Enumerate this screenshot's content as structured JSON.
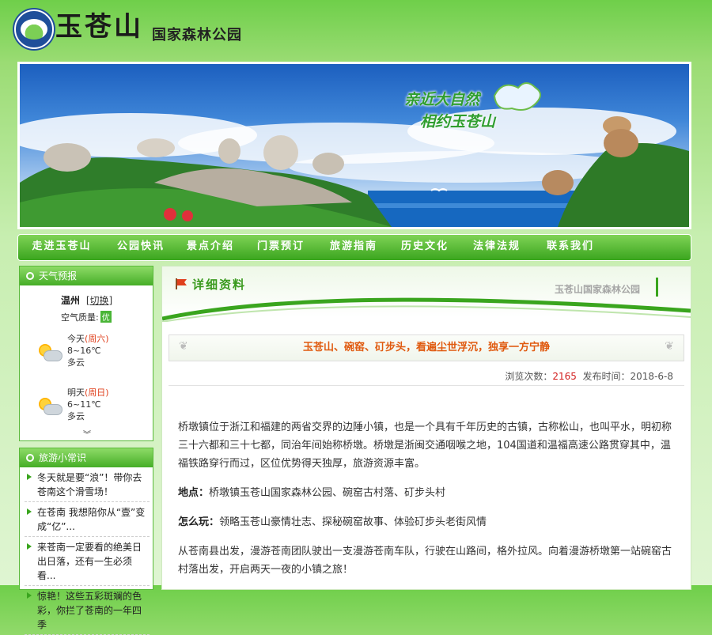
{
  "site": {
    "brand": "玉苍山",
    "subtitle": "国家森林公园"
  },
  "banner": {
    "slogan_line1": "亲近大自然",
    "slogan_line2": "相约玉苍山"
  },
  "nav": {
    "items": [
      "走进玉苍山",
      "公园快讯",
      "景点介绍",
      "门票预订",
      "旅游指南",
      "历史文化",
      "法律法规",
      "联系我们"
    ]
  },
  "weather": {
    "title": "天气预报",
    "city": "温州",
    "switch": "[切换]",
    "air_quality_label": "空气质量:",
    "air_quality_value": "优",
    "days": [
      {
        "label": "今天",
        "weekday": "(周六)",
        "temp": "8~16℃",
        "cond": "多云"
      },
      {
        "label": "明天",
        "weekday": "(周日)",
        "temp": "6~11℃",
        "cond": "多云"
      }
    ],
    "more": "︾"
  },
  "tips": {
    "title": "旅游小常识",
    "items": [
      "冬天就是要“浪”！带你去苍南这个滑雪场！",
      "在苍南 我想陪你从“壹”变成“亿”...",
      "来苍南一定要看的绝美日出日落，还有一生必须看...",
      "惊艳！这些五彩斑斓的色彩，你拦了苍南的一年四季"
    ]
  },
  "main": {
    "title": "详细资料",
    "watermark": "玉苍山国家森林公园",
    "headline": "玉苍山、碗窑、矴步头，看遍尘世浮沉，独享一方宁静",
    "views_label": "浏览次数：",
    "views": "2165",
    "date_label": "发布时间：",
    "date": "2018-6-8",
    "para1": "桥墩镇位于浙江和福建的两省交界的边陲小镇，也是一个具有千年历史的古镇，古称松山，也叫平水，明初称三十六都和三十七都，同治年间始称桥墩。桥墩是浙闽交通咽喉之地，104国道和温福高速公路贯穿其中，温福铁路穿行而过，区位优势得天独厚，旅游资源丰富。",
    "place_label": "地点：",
    "place": "桥墩镇玉苍山国家森林公园、碗窑古村落、矴步头村",
    "play_label": "怎么玩：",
    "play": "领略玉苍山豪情壮志、探秘碗窑故事、体验矴步头老街风情",
    "para4": "从苍南县出发，漫游苍南团队驶出一支漫游苍南车队，行驶在山路间，格外拉风。向着漫游桥墩第一站碗窑古村落出发，开启两天一夜的小镇之旅！"
  },
  "colors": {
    "accent_green": "#3aa51e",
    "alert_red": "#d21e1e",
    "headline_orange": "#e05a10"
  }
}
